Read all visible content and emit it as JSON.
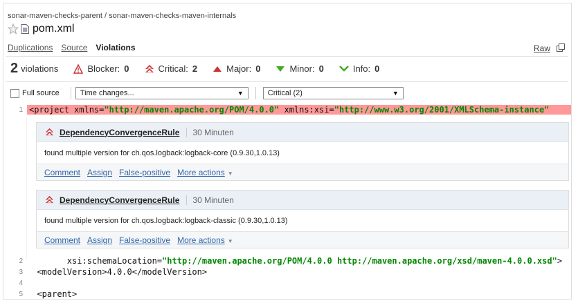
{
  "breadcrumb": "sonar-maven-checks-parent / sonar-maven-checks-maven-internals",
  "file": {
    "name": "pom.xml",
    "star_icon": "star-icon",
    "file_icon": "file-icon"
  },
  "tabs": [
    {
      "label": "Duplications"
    },
    {
      "label": "Source"
    },
    {
      "label": "Violations",
      "active": true
    }
  ],
  "raw_label": "Raw",
  "summary": {
    "count": "2",
    "count_label": "violations",
    "severities": [
      {
        "label": "Blocker:",
        "value": "0",
        "icon": "blocker-icon",
        "color": "#cc3333"
      },
      {
        "label": "Critical:",
        "value": "2",
        "icon": "critical-icon",
        "color": "#cc3333"
      },
      {
        "label": "Major:",
        "value": "0",
        "icon": "major-icon",
        "color": "#cc3333"
      },
      {
        "label": "Minor:",
        "value": "0",
        "icon": "minor-icon",
        "color": "#44aa22"
      },
      {
        "label": "Info:",
        "value": "0",
        "icon": "info-icon",
        "color": "#44aa22"
      }
    ]
  },
  "filters": {
    "full_source_label": "Full source",
    "time_select": "Time changes...",
    "severity_select": "Critical (2)"
  },
  "lines": {
    "l1": {
      "num": "1",
      "pre": "<project xmlns=",
      "s1": "\"http://maven.apache.org/POM/4.0.0\"",
      "mid": " xmlns:xsi=",
      "s2": "\"http://www.w3.org/2001/XMLSchema-instance\""
    },
    "l2": {
      "num": "2",
      "pre": "        xsi:schemaLocation=",
      "s1": "\"http://maven.apache.org/POM/4.0.0 http://maven.apache.org/xsd/maven-4.0.0.xsd\"",
      "post": ">"
    },
    "l3": {
      "num": "3",
      "text": "  <modelVersion>4.0.0</modelVersion>"
    },
    "l4": {
      "num": "4",
      "text": ""
    },
    "l5": {
      "num": "5",
      "text": "  <parent>"
    }
  },
  "issues": [
    {
      "rule": "DependencyConvergenceRule",
      "duration": "30 Minuten",
      "message": "found multiple version for ch.qos.logback:logback-core (0.9.30,1.0.13)",
      "actions": {
        "comment": "Comment",
        "assign": "Assign",
        "false_positive": "False-positive",
        "more": "More actions"
      }
    },
    {
      "rule": "DependencyConvergenceRule",
      "duration": "30 Minuten",
      "message": "found multiple version for ch.qos.logback:logback-classic (0.9.30,1.0.13)",
      "actions": {
        "comment": "Comment",
        "assign": "Assign",
        "false_positive": "False-positive",
        "more": "More actions"
      }
    }
  ]
}
